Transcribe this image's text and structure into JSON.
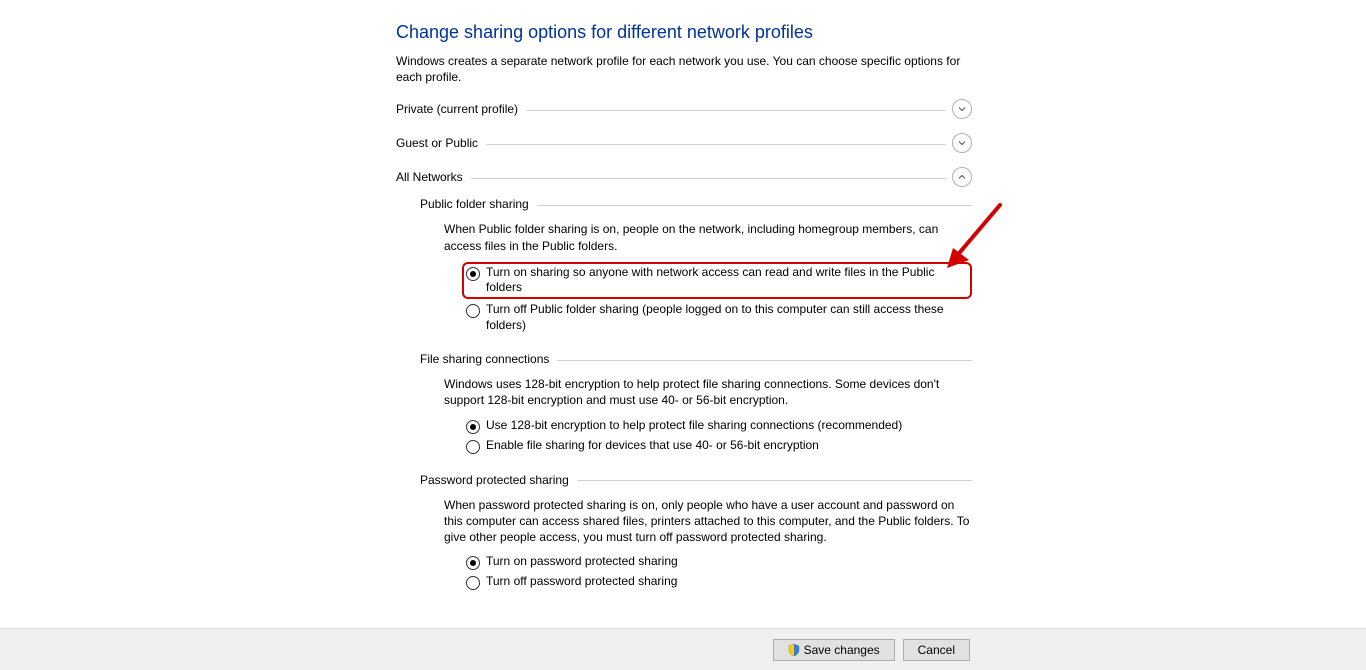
{
  "page": {
    "title": "Change sharing options for different network profiles",
    "description": "Windows creates a separate network profile for each network you use. You can choose specific options for each profile."
  },
  "sections": {
    "private": {
      "label": "Private (current profile)"
    },
    "guest": {
      "label": "Guest or Public"
    },
    "all": {
      "label": "All Networks"
    }
  },
  "public_folder_sharing": {
    "heading": "Public folder sharing",
    "description": "When Public folder sharing is on, people on the network, including homegroup members, can access files in the Public folders.",
    "option_on": "Turn on sharing so anyone with network access can read and write files in the Public folders",
    "option_off": "Turn off Public folder sharing (people logged on to this computer can still access these folders)"
  },
  "file_sharing_connections": {
    "heading": "File sharing connections",
    "description": "Windows uses 128-bit encryption to help protect file sharing connections. Some devices don't support 128-bit encryption and must use 40- or 56-bit encryption.",
    "option_128": "Use 128-bit encryption to help protect file sharing connections (recommended)",
    "option_40": "Enable file sharing for devices that use 40- or 56-bit encryption"
  },
  "password_protected_sharing": {
    "heading": "Password protected sharing",
    "description": "When password protected sharing is on, only people who have a user account and password on this computer can access shared files, printers attached to this computer, and the Public folders. To give other people access, you must turn off password protected sharing.",
    "option_on": "Turn on password protected sharing",
    "option_off": "Turn off password protected sharing"
  },
  "buttons": {
    "save": "Save changes",
    "cancel": "Cancel"
  }
}
